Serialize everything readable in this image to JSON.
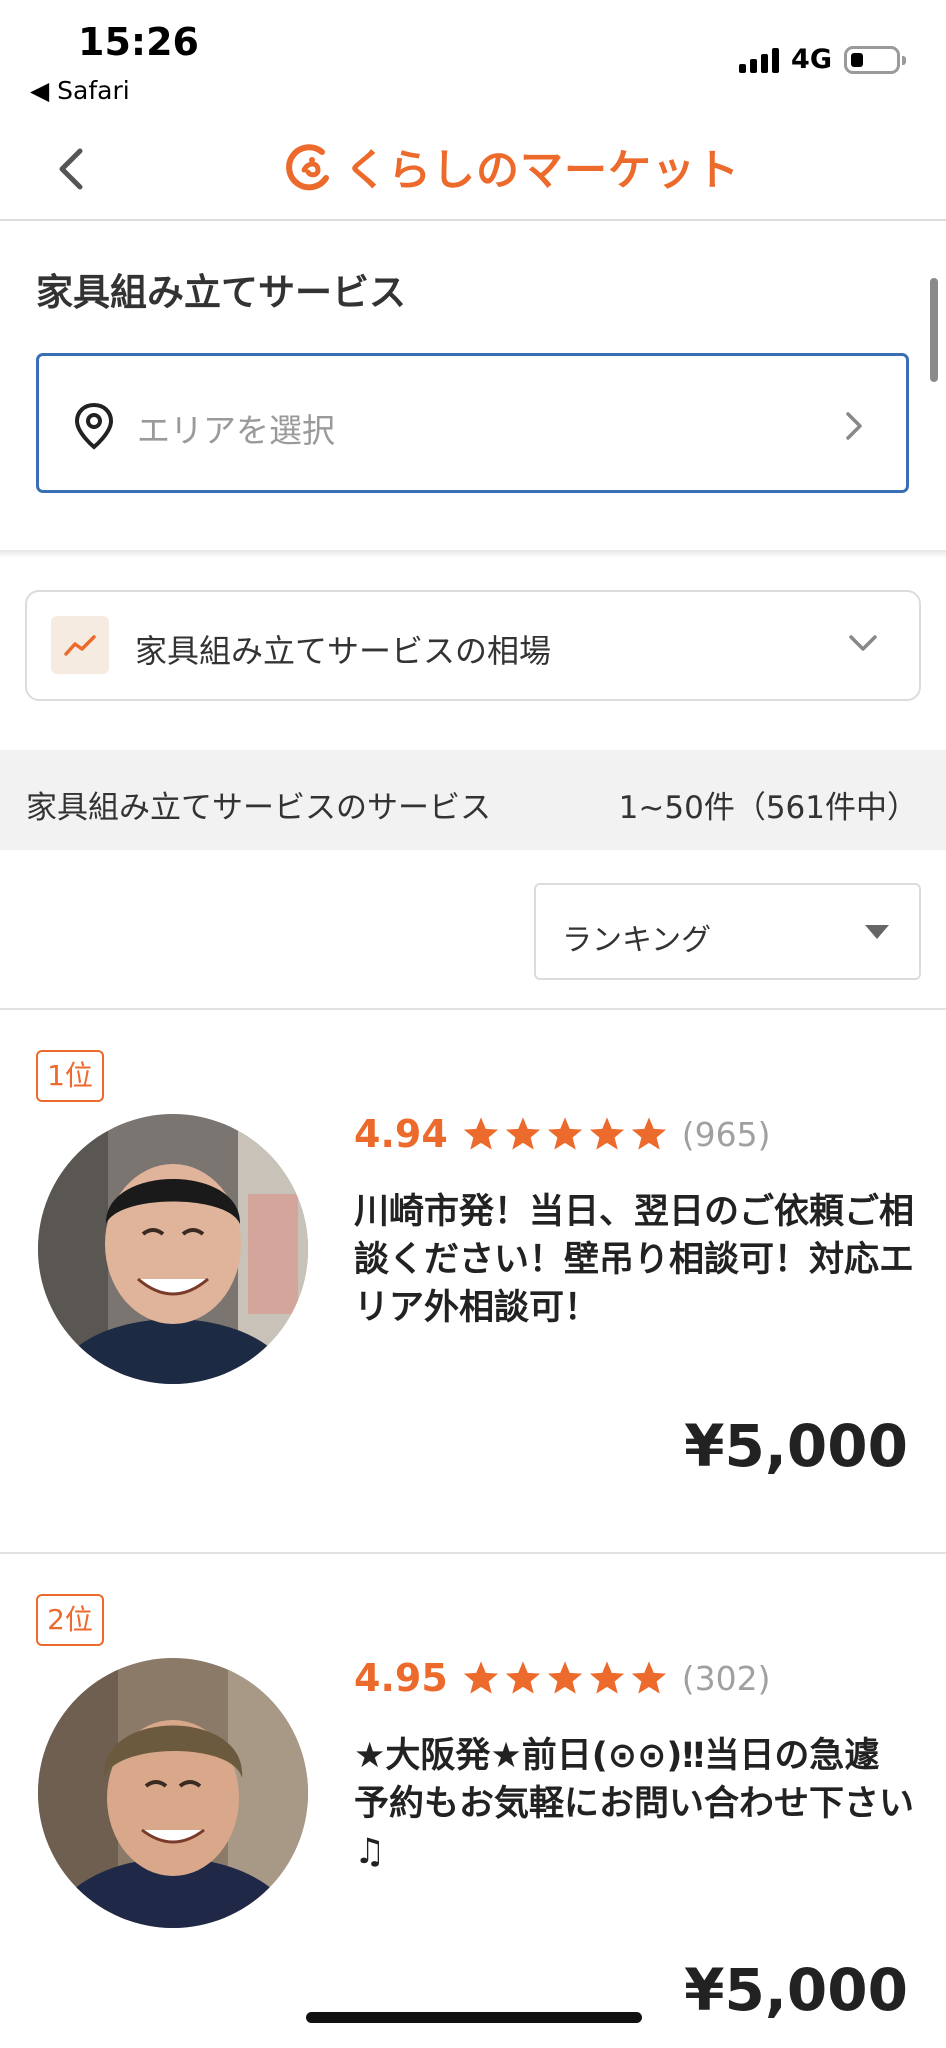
{
  "status_bar": {
    "time": "15:26",
    "back_app": "◀ Safari",
    "network": "4G"
  },
  "header": {
    "logo_text": "くらしのマーケット",
    "back_icon": "chevron-left-icon",
    "brand_color": "#ec6a2c"
  },
  "search": {
    "category_title": "家具組み立てサービス",
    "area_placeholder": "エリアを選択",
    "pin_icon": "location-pin-icon",
    "accent_color": "#3a6fb6"
  },
  "price_panel": {
    "label": "家具組み立てサービスの相場",
    "icon": "trend-chart-icon"
  },
  "results": {
    "label": "家具組み立てサービスのサービス",
    "count": "1~50件（561件中）"
  },
  "sort": {
    "selected": "ランキング"
  },
  "listings": [
    {
      "rank": "1位",
      "rating": "4.94",
      "stars": 5,
      "reviews": "(965)",
      "title": "川崎市発！当日、翌日のご依頼ご相談ください！壁吊り相談可！対応エリア外相談可！",
      "price": "¥5,000"
    },
    {
      "rank": "2位",
      "rating": "4.95",
      "stars": 5,
      "reviews": "(302)",
      "title": "★大阪発★前日(⊙⊙)‼当日の急遽予約もお気軽にお問い合わせ下さい♫",
      "price": "¥5,000"
    }
  ]
}
